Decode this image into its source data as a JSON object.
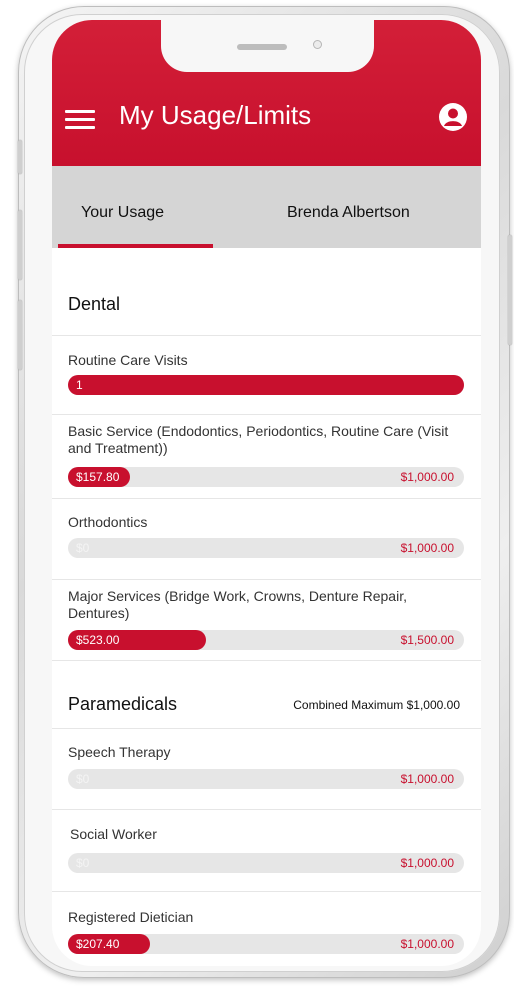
{
  "app": {
    "title": "My Usage/Limits",
    "menu_icon": "hamburger-menu-icon",
    "profile_icon": "user-circle-icon",
    "accent": "#c8102e"
  },
  "tabs": [
    {
      "label": "Your Usage",
      "active": true
    },
    {
      "label": "Brenda Albertson",
      "active": false
    }
  ],
  "dental": {
    "heading": "Dental",
    "items": [
      {
        "label": "Routine Care Visits",
        "used": "1",
        "limit": "",
        "fill": 1.0
      },
      {
        "label": "Basic Service (Endodontics, Periodontics, Routine Care (Visit and Treatment))",
        "used": "$157.80",
        "limit": "$1,000.00",
        "fill": 0.1578
      },
      {
        "label": "Orthodontics",
        "used": "$0",
        "limit": "$1,000.00",
        "fill": 0
      },
      {
        "label": "Major Services (Bridge Work, Crowns, Denture Repair, Dentures)",
        "used": "$523.00",
        "limit": "$1,500.00",
        "fill": 0.3487
      }
    ]
  },
  "paramedicals": {
    "heading": "Paramedicals",
    "combined": "Combined Maximum $1,000.00",
    "items": [
      {
        "label": "Speech Therapy",
        "used": "$0",
        "limit": "$1,000.00",
        "fill": 0
      },
      {
        "label": "Social Worker",
        "used": "$0",
        "limit": "$1,000.00",
        "fill": 0
      },
      {
        "label": "Registered Dietician",
        "used": "$207.40",
        "limit": "$1,000.00",
        "fill": 0.2074
      }
    ]
  }
}
